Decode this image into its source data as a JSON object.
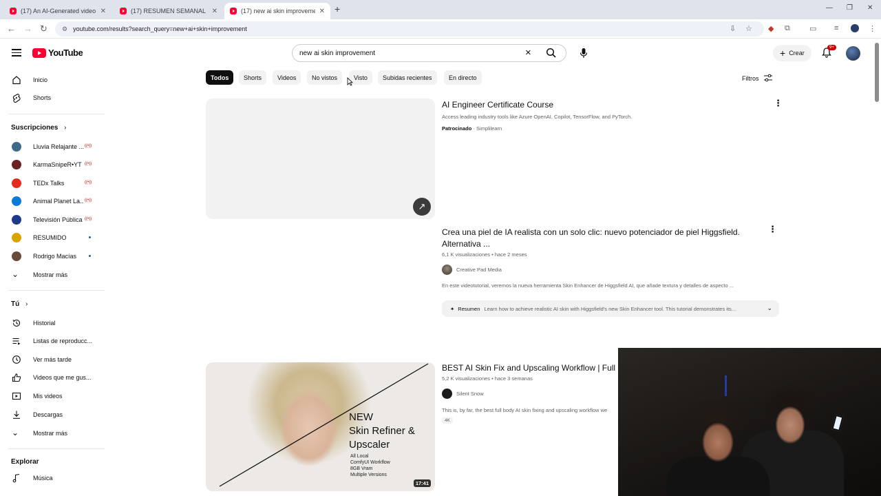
{
  "browser": {
    "tabs": [
      {
        "title": "(17) An AI-Generated video of l"
      },
      {
        "title": "(17) RESUMEN SEMANAL FEBR"
      },
      {
        "title": "(17) new ai skin improvement -"
      }
    ],
    "url": "youtube.com/results?search_query=new+ai+skin+improvement"
  },
  "header": {
    "logo_text": "YouTube",
    "search_value": "new ai skin improvement",
    "create_label": "Crear",
    "notif_count": "9+"
  },
  "sidebar": {
    "main": [
      {
        "label": "Inicio",
        "icon": "home-icon"
      },
      {
        "label": "Shorts",
        "icon": "shorts-icon"
      }
    ],
    "subs_heading": "Suscripciones",
    "subs": [
      {
        "label": "Lluvia Relajante ...",
        "status": "live",
        "color": "#3e6b8a"
      },
      {
        "label": "KarmaSnipeR•YT",
        "status": "live",
        "color": "#6b2222"
      },
      {
        "label": "TEDx Talks",
        "status": "live",
        "color": "#e62b1e"
      },
      {
        "label": "Animal Planet La...",
        "status": "live",
        "color": "#0a7bd6"
      },
      {
        "label": "Televisión Pública",
        "status": "live",
        "color": "#1e3b8a"
      },
      {
        "label": "RESUMIDO",
        "status": "new",
        "color": "#d9a400"
      },
      {
        "label": "Rodrigo Macías",
        "status": "new",
        "color": "#6a4a3a"
      }
    ],
    "subs_more": "Mostrar más",
    "you_heading": "Tú",
    "you": [
      {
        "label": "Historial",
        "icon": "history-icon"
      },
      {
        "label": "Listas de reproducc...",
        "icon": "playlist-icon"
      },
      {
        "label": "Ver más tarde",
        "icon": "clock-icon"
      },
      {
        "label": "Videos que me gus...",
        "icon": "like-icon"
      },
      {
        "label": "Mis videos",
        "icon": "my-videos-icon"
      },
      {
        "label": "Descargas",
        "icon": "download-icon"
      }
    ],
    "you_more": "Mostrar más",
    "explore_heading": "Explorar",
    "explore": [
      {
        "label": "Música",
        "icon": "music-icon"
      }
    ]
  },
  "chips": [
    "Todos",
    "Shorts",
    "Videos",
    "No vistos",
    "Visto",
    "Subidas recientes",
    "En directo"
  ],
  "filters_label": "Filtros",
  "results": {
    "ad": {
      "title": "AI Engineer Certificate Course",
      "desc": "Access leading industry tools like Azure OpenAI, Copilot, TensorFlow, and PyTorch.",
      "sponsored": "Patrocinado",
      "sep": "·",
      "advertiser": "Simplilearn"
    },
    "video1": {
      "title_line1": "Crea una piel de IA realista con un solo clic: nuevo potenciador de piel Higgsfield.",
      "title_line2": "Alternativa ...",
      "meta": "6,1 K visualizaciones • hace 2 meses",
      "channel": "Creative Pad Media",
      "desc": "En este videotutorial, veremos la nueva herramienta Skin Enhancer de Higgsfield AI, que añade textura y detalles de aspecto ...",
      "summary_label": "Resumen",
      "summary_text": "Learn how to achieve realistic AI skin with Higgsfield's new Skin Enhancer tool. This tutorial demonstrates its..."
    },
    "video2": {
      "title": "BEST AI Skin Fix and Upscaling Workflow | Full B",
      "meta": "5,2 K visualizaciones • hace 3 semanas",
      "channel": "Silent Snow",
      "desc": "This is, by far, the best full body AI skin fixing and upscaling workflow we",
      "badge": "4K",
      "thumb_title_1": "NEW",
      "thumb_title_2": "Skin Refiner &",
      "thumb_title_3": "Upscaler",
      "thumb_sub_1": "All Local",
      "thumb_sub_2": "ComfyUI Workflow",
      "thumb_sub_3": "8GB Vram",
      "thumb_sub_4": "Multiple Versions",
      "duration": "17:41"
    }
  }
}
